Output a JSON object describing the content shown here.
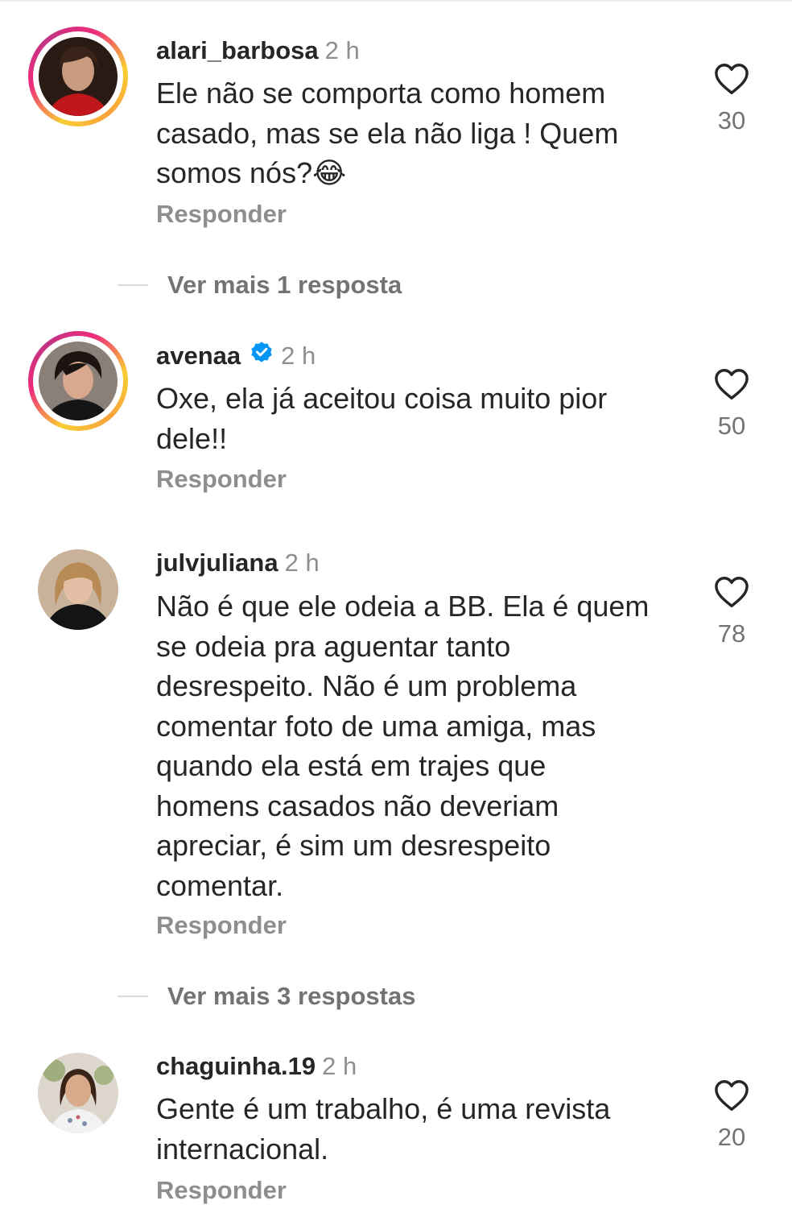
{
  "comments": [
    {
      "username": "alari_barbosa",
      "time": "2 h",
      "text": "Ele não se comporta como homem casado, mas se ela não liga ! Quem somos nós?😂",
      "reply_label": "Responder",
      "likes": "30",
      "story_ring": true,
      "verified": false
    },
    {
      "username": "avenaa",
      "time": "2 h",
      "text": "Oxe, ela já aceitou coisa muito pior dele!!",
      "reply_label": "Responder",
      "likes": "50",
      "story_ring": true,
      "verified": true
    },
    {
      "username": "julvjuliana",
      "time": "2 h",
      "text": "Não é que ele odeia a BB. Ela é quem se odeia pra aguentar tanto desrespeito. Não é um problema comentar foto de uma amiga, mas quando ela está em trajes que homens casados não deveriam apreciar, é sim um desrespeito comentar.",
      "reply_label": "Responder",
      "likes": "78",
      "story_ring": false,
      "verified": false
    },
    {
      "username": "chaguinha.19",
      "time": "2 h",
      "text": "Gente é um trabalho, é uma revista internacional.",
      "reply_label": "Responder",
      "likes": "20",
      "story_ring": false,
      "verified": false
    }
  ],
  "view_more": [
    {
      "label": "Ver mais 1 resposta"
    },
    {
      "label": "Ver mais 3 respostas"
    }
  ],
  "colors": {
    "text": "#262626",
    "secondary": "#8e8e8e",
    "verified_blue": "#0095f6",
    "story_gradient": [
      "#f9ce34",
      "#ee2a7b",
      "#c13584"
    ]
  },
  "icons": {
    "like": "heart-outline-icon",
    "verified": "verified-badge-icon"
  }
}
